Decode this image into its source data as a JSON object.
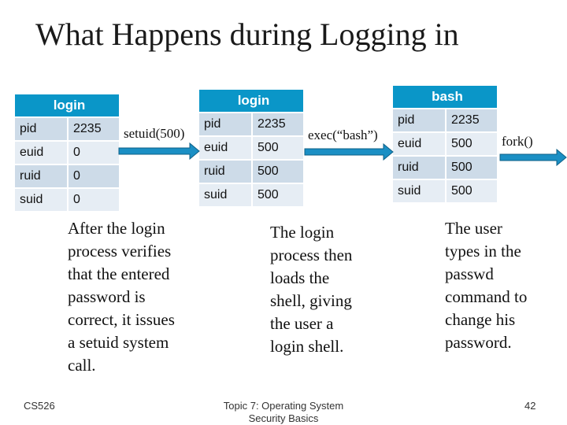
{
  "title": "What Happens during Logging in",
  "processes": [
    {
      "name": "login",
      "rows": [
        {
          "key": "pid",
          "value": "2235"
        },
        {
          "key": "euid",
          "value": "0"
        },
        {
          "key": "ruid",
          "value": "0"
        },
        {
          "key": "suid",
          "value": "0"
        }
      ]
    },
    {
      "name": "login",
      "rows": [
        {
          "key": "pid",
          "value": "2235"
        },
        {
          "key": "euid",
          "value": "500"
        },
        {
          "key": "ruid",
          "value": "500"
        },
        {
          "key": "suid",
          "value": "500"
        }
      ]
    },
    {
      "name": "bash",
      "rows": [
        {
          "key": "pid",
          "value": "2235"
        },
        {
          "key": "euid",
          "value": "500"
        },
        {
          "key": "ruid",
          "value": "500"
        },
        {
          "key": "suid",
          "value": "500"
        }
      ]
    }
  ],
  "arrows": [
    {
      "label": "setuid(500)"
    },
    {
      "label": "exec(“bash”)"
    },
    {
      "label": "fork()"
    }
  ],
  "notes": [
    [
      "After the login",
      "process verifies",
      "that the entered",
      "password is",
      "correct, it issues",
      "a setuid system",
      "call."
    ],
    [
      "The login",
      "process then",
      "loads the",
      "shell, giving",
      "the user a",
      "login shell."
    ],
    [
      "The user",
      "types in the",
      "passwd",
      "command to",
      "change his",
      "password."
    ]
  ],
  "footer": {
    "left": "CS526",
    "center_line1": "Topic 7: Operating System",
    "center_line2": "Security Basics",
    "page": "42"
  },
  "colors": {
    "header": "#0a96c8",
    "row_dark": "#cddbe8",
    "row_light": "#e6edf4",
    "arrow": "#1b8fc4"
  }
}
